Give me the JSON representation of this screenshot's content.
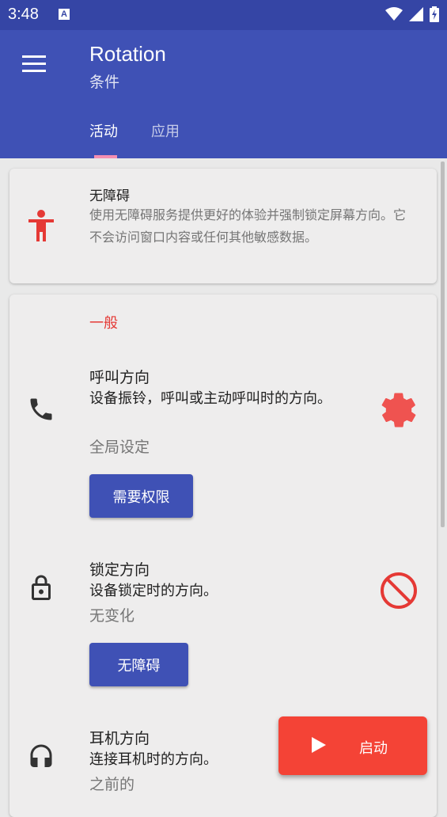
{
  "status_bar": {
    "time": "3:48",
    "notification_icon": "A"
  },
  "app_bar": {
    "title": "Rotation",
    "subtitle": "条件",
    "tabs": [
      {
        "label": "活动",
        "active": true
      },
      {
        "label": "应用",
        "active": false
      }
    ]
  },
  "accessibility_card": {
    "title": "无障碍",
    "description": "使用无障碍服务提供更好的体验并强制锁定屏幕方向。它不会访问窗口内容或任何其他敏感数据。"
  },
  "general_section": {
    "header": "一般",
    "items": [
      {
        "title": "呼叫方向",
        "description": "设备振铃，呼叫或主动呼叫时的方向。",
        "value": "全局设定",
        "button": "需要权限",
        "icon": "phone-icon",
        "right_icon": "settings-gear-icon"
      },
      {
        "title": "锁定方向",
        "description": "设备锁定时的方向。",
        "value": "无变化",
        "button": "无障碍",
        "icon": "lock-icon",
        "right_icon": "block-icon"
      },
      {
        "title": "耳机方向",
        "description": "连接耳机时的方向。",
        "value": "之前的",
        "icon": "headset-icon"
      }
    ]
  },
  "fab": {
    "label": "启动"
  },
  "colors": {
    "primary": "#3f51b5",
    "accent": "#f44336",
    "status_bar": "#3545a5"
  }
}
